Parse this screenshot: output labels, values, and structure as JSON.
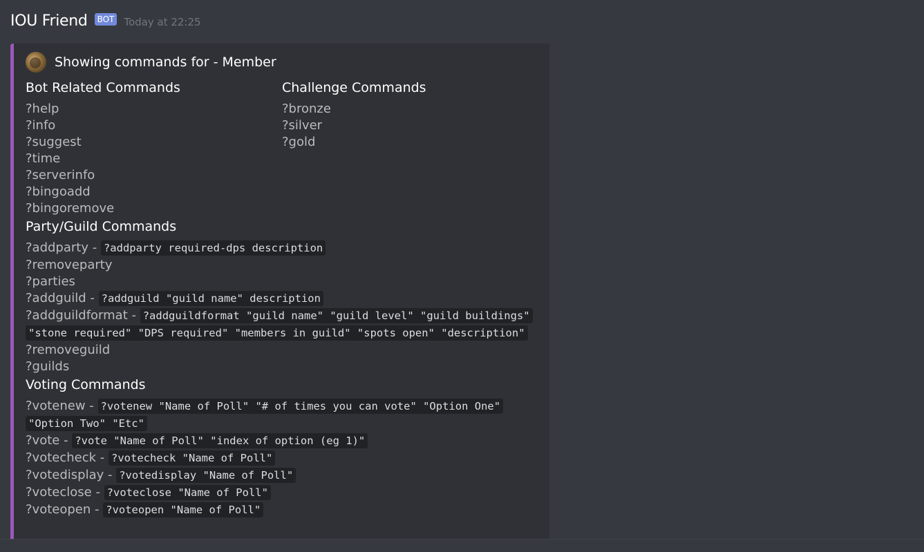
{
  "message": {
    "username": "IOU Friend",
    "bot_tag": "BOT",
    "timestamp": "Today at 22:25"
  },
  "embed": {
    "accent_color": "#9b59b6",
    "author": "Showing commands for - Member",
    "fields": {
      "bot_related": {
        "name": "Bot Related Commands",
        "items": [
          "?help",
          "?info",
          "?suggest",
          "?time",
          "?serverinfo",
          "?bingoadd",
          "?bingoremove"
        ]
      },
      "challenge": {
        "name": "Challenge Commands",
        "items": [
          "?bronze",
          "?silver",
          "?gold"
        ]
      },
      "party_guild": {
        "name": "Party/Guild Commands",
        "items": [
          {
            "cmd": "?addparty",
            "usage": "?addparty required-dps description"
          },
          {
            "cmd": "?removeparty",
            "usage": ""
          },
          {
            "cmd": "?parties",
            "usage": ""
          },
          {
            "cmd": "?addguild",
            "usage": "?addguild \"guild name\" description"
          },
          {
            "cmd": "?addguildformat",
            "usage": "?addguildformat \"guild name\" \"guild level\" \"guild buildings\" \"stone required\" \"DPS required\" \"members in guild\" \"spots open\" \"description\""
          },
          {
            "cmd": "?removeguild",
            "usage": ""
          },
          {
            "cmd": "?guilds",
            "usage": ""
          }
        ]
      },
      "voting": {
        "name": "Voting Commands",
        "items": [
          {
            "cmd": "?votenew",
            "usage": "?votenew \"Name of Poll\" \"# of times you can vote\" \"Option One\" \"Option Two\" \"Etc\""
          },
          {
            "cmd": "?vote",
            "usage": "?vote \"Name of Poll\" \"index of option (eg 1)\""
          },
          {
            "cmd": "?votecheck",
            "usage": "?votecheck \"Name of Poll\""
          },
          {
            "cmd": "?votedisplay",
            "usage": "?votedisplay \"Name of Poll\""
          },
          {
            "cmd": "?voteclose",
            "usage": "?voteclose \"Name of Poll\""
          },
          {
            "cmd": "?voteopen",
            "usage": "?voteopen \"Name of Poll\""
          }
        ]
      }
    },
    "separator": " - "
  },
  "colors": {
    "background": "#36393f",
    "embed_background": "#2f3136",
    "bot_tag": "#7289da",
    "code_background": "#202225"
  }
}
